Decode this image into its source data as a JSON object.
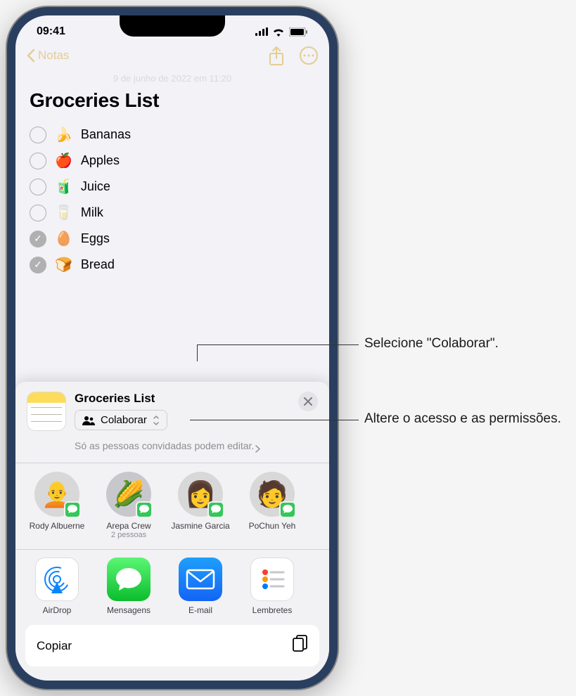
{
  "status": {
    "time": "09:41"
  },
  "nav": {
    "back": "Notas"
  },
  "note": {
    "date": "9 de junho de 2022 em 11:20",
    "title": "Groceries List",
    "items": [
      {
        "emoji": "🍌",
        "text": "Bananas",
        "checked": false
      },
      {
        "emoji": "🍎",
        "text": "Apples",
        "checked": false
      },
      {
        "emoji": "🧃",
        "text": "Juice",
        "checked": false
      },
      {
        "emoji": "🥛",
        "text": "Milk",
        "checked": false
      },
      {
        "emoji": "🥚",
        "text": "Eggs",
        "checked": true
      },
      {
        "emoji": "🍞",
        "text": "Bread",
        "checked": true
      }
    ]
  },
  "share": {
    "title": "Groceries List",
    "collaborate_label": "Colaborar",
    "permission_text": "Só as pessoas convidadas podem editar.",
    "contacts": [
      {
        "name": "Rody Albuerne",
        "sub": "",
        "emoji": "🧑‍🦲"
      },
      {
        "name": "Arepa Crew",
        "sub": "2 pessoas",
        "emoji": "🌽"
      },
      {
        "name": "Jasmine Garcia",
        "sub": "",
        "emoji": "👩"
      },
      {
        "name": "PoChun Yeh",
        "sub": "",
        "emoji": "🧑"
      }
    ],
    "apps": [
      {
        "name": "AirDrop"
      },
      {
        "name": "Mensagens"
      },
      {
        "name": "E-mail"
      },
      {
        "name": "Lembretes"
      }
    ],
    "copy_label": "Copiar"
  },
  "callouts": {
    "c1": "Selecione \"Colaborar\".",
    "c2": "Altere o acesso e as permissões."
  }
}
